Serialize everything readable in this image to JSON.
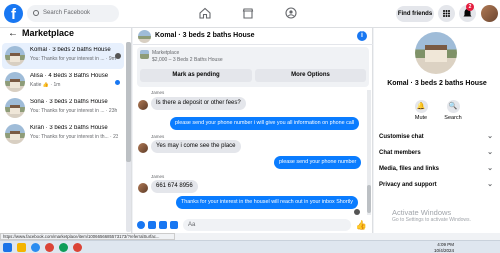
{
  "topbar": {
    "logo": "f",
    "search_placeholder": "Search Facebook",
    "find_friends": "Find friends",
    "notif_count": "2"
  },
  "left": {
    "title": "Marketplace",
    "conversations": [
      {
        "title": "Komal · 3 beds 2 baths House",
        "sub": "You: Thanks for your interest in ... · 9m",
        "active": true
      },
      {
        "title": "Alisa · 4 Beds 3 Baths House",
        "sub": "Katie 👍 · 1m",
        "unread": true
      },
      {
        "title": "Sona · 3 beds 2 baths House",
        "sub": "You: Thanks for your interest in ... · 23h"
      },
      {
        "title": "Kiran · 3 beds 2 baths House",
        "sub": "You: Thanks for your interest in th... · 23h"
      }
    ]
  },
  "chat": {
    "header_title": "Komal · 3 beds 2 baths House",
    "marketplace_label": "Marketplace",
    "price_line": "$2,000 – 3 Beds 2 Baths House",
    "mark_pending": "Mark as pending",
    "more_options": "More Options",
    "messages": [
      {
        "from": "in",
        "name": "James",
        "text": "Is there a deposit or other fees?"
      },
      {
        "from": "out",
        "text": "please send your phone number i will give you all information on phone call"
      },
      {
        "from": "in",
        "name": "James",
        "text": "Yes may i come see the place"
      },
      {
        "from": "out",
        "text": "please send your phone number"
      },
      {
        "from": "in",
        "name": "James",
        "text": "661 674 8956"
      },
      {
        "from": "out",
        "text": "Thanks for your interest in the housel will reach out in your inbox Shortly"
      }
    ],
    "composer_placeholder": "Aa"
  },
  "right": {
    "title": "Komal · 3 beds 2 baths House",
    "mute": "Mute",
    "search": "Search",
    "sections": [
      "Customise chat",
      "Chat members",
      "Media, files and links",
      "Privacy and support"
    ]
  },
  "watermark": {
    "title": "Activate Windows",
    "sub": "Go to Settings to activate Windows."
  },
  "status_url": "https://www.facebook.com/marketplace/item/1006656685573173/?referralSurfac...",
  "tray": {
    "time": "4:09 PM",
    "date": "10/4/2024"
  },
  "colors": {
    "brand": "#1877f2",
    "outgoing": "#0a7cff",
    "badge": "#e41e3f"
  }
}
